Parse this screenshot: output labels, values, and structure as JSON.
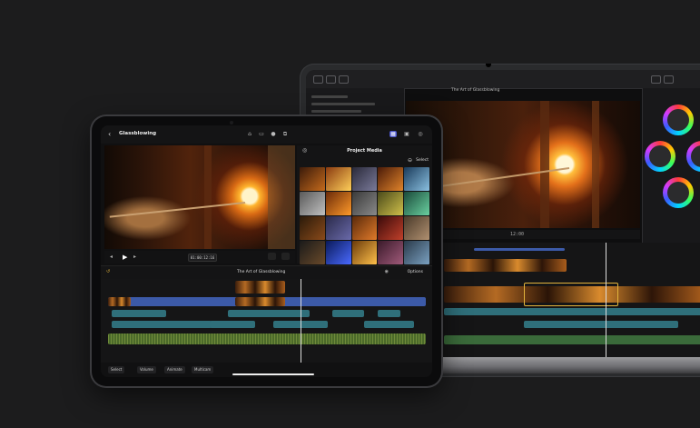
{
  "laptop": {
    "project_title": "The Art of Glassblowing",
    "timecode": "12:00"
  },
  "tablet": {
    "back_glyph": "‹",
    "project_name": "Glassblowing",
    "media_title": "Project Media",
    "select_label": "Select",
    "timecode": "01:00:12:16",
    "timeline_title": "The Art of Glassblowing",
    "options_label": "Options",
    "footer_buttons": [
      "Select",
      "Volume",
      "Animate",
      "Multicam"
    ]
  },
  "colors": {
    "clip_blue": "#3c5aa8",
    "clip_teal": "#2f6f7a",
    "audio_green": "#3a6a3a",
    "selection": "#e3b43c"
  }
}
